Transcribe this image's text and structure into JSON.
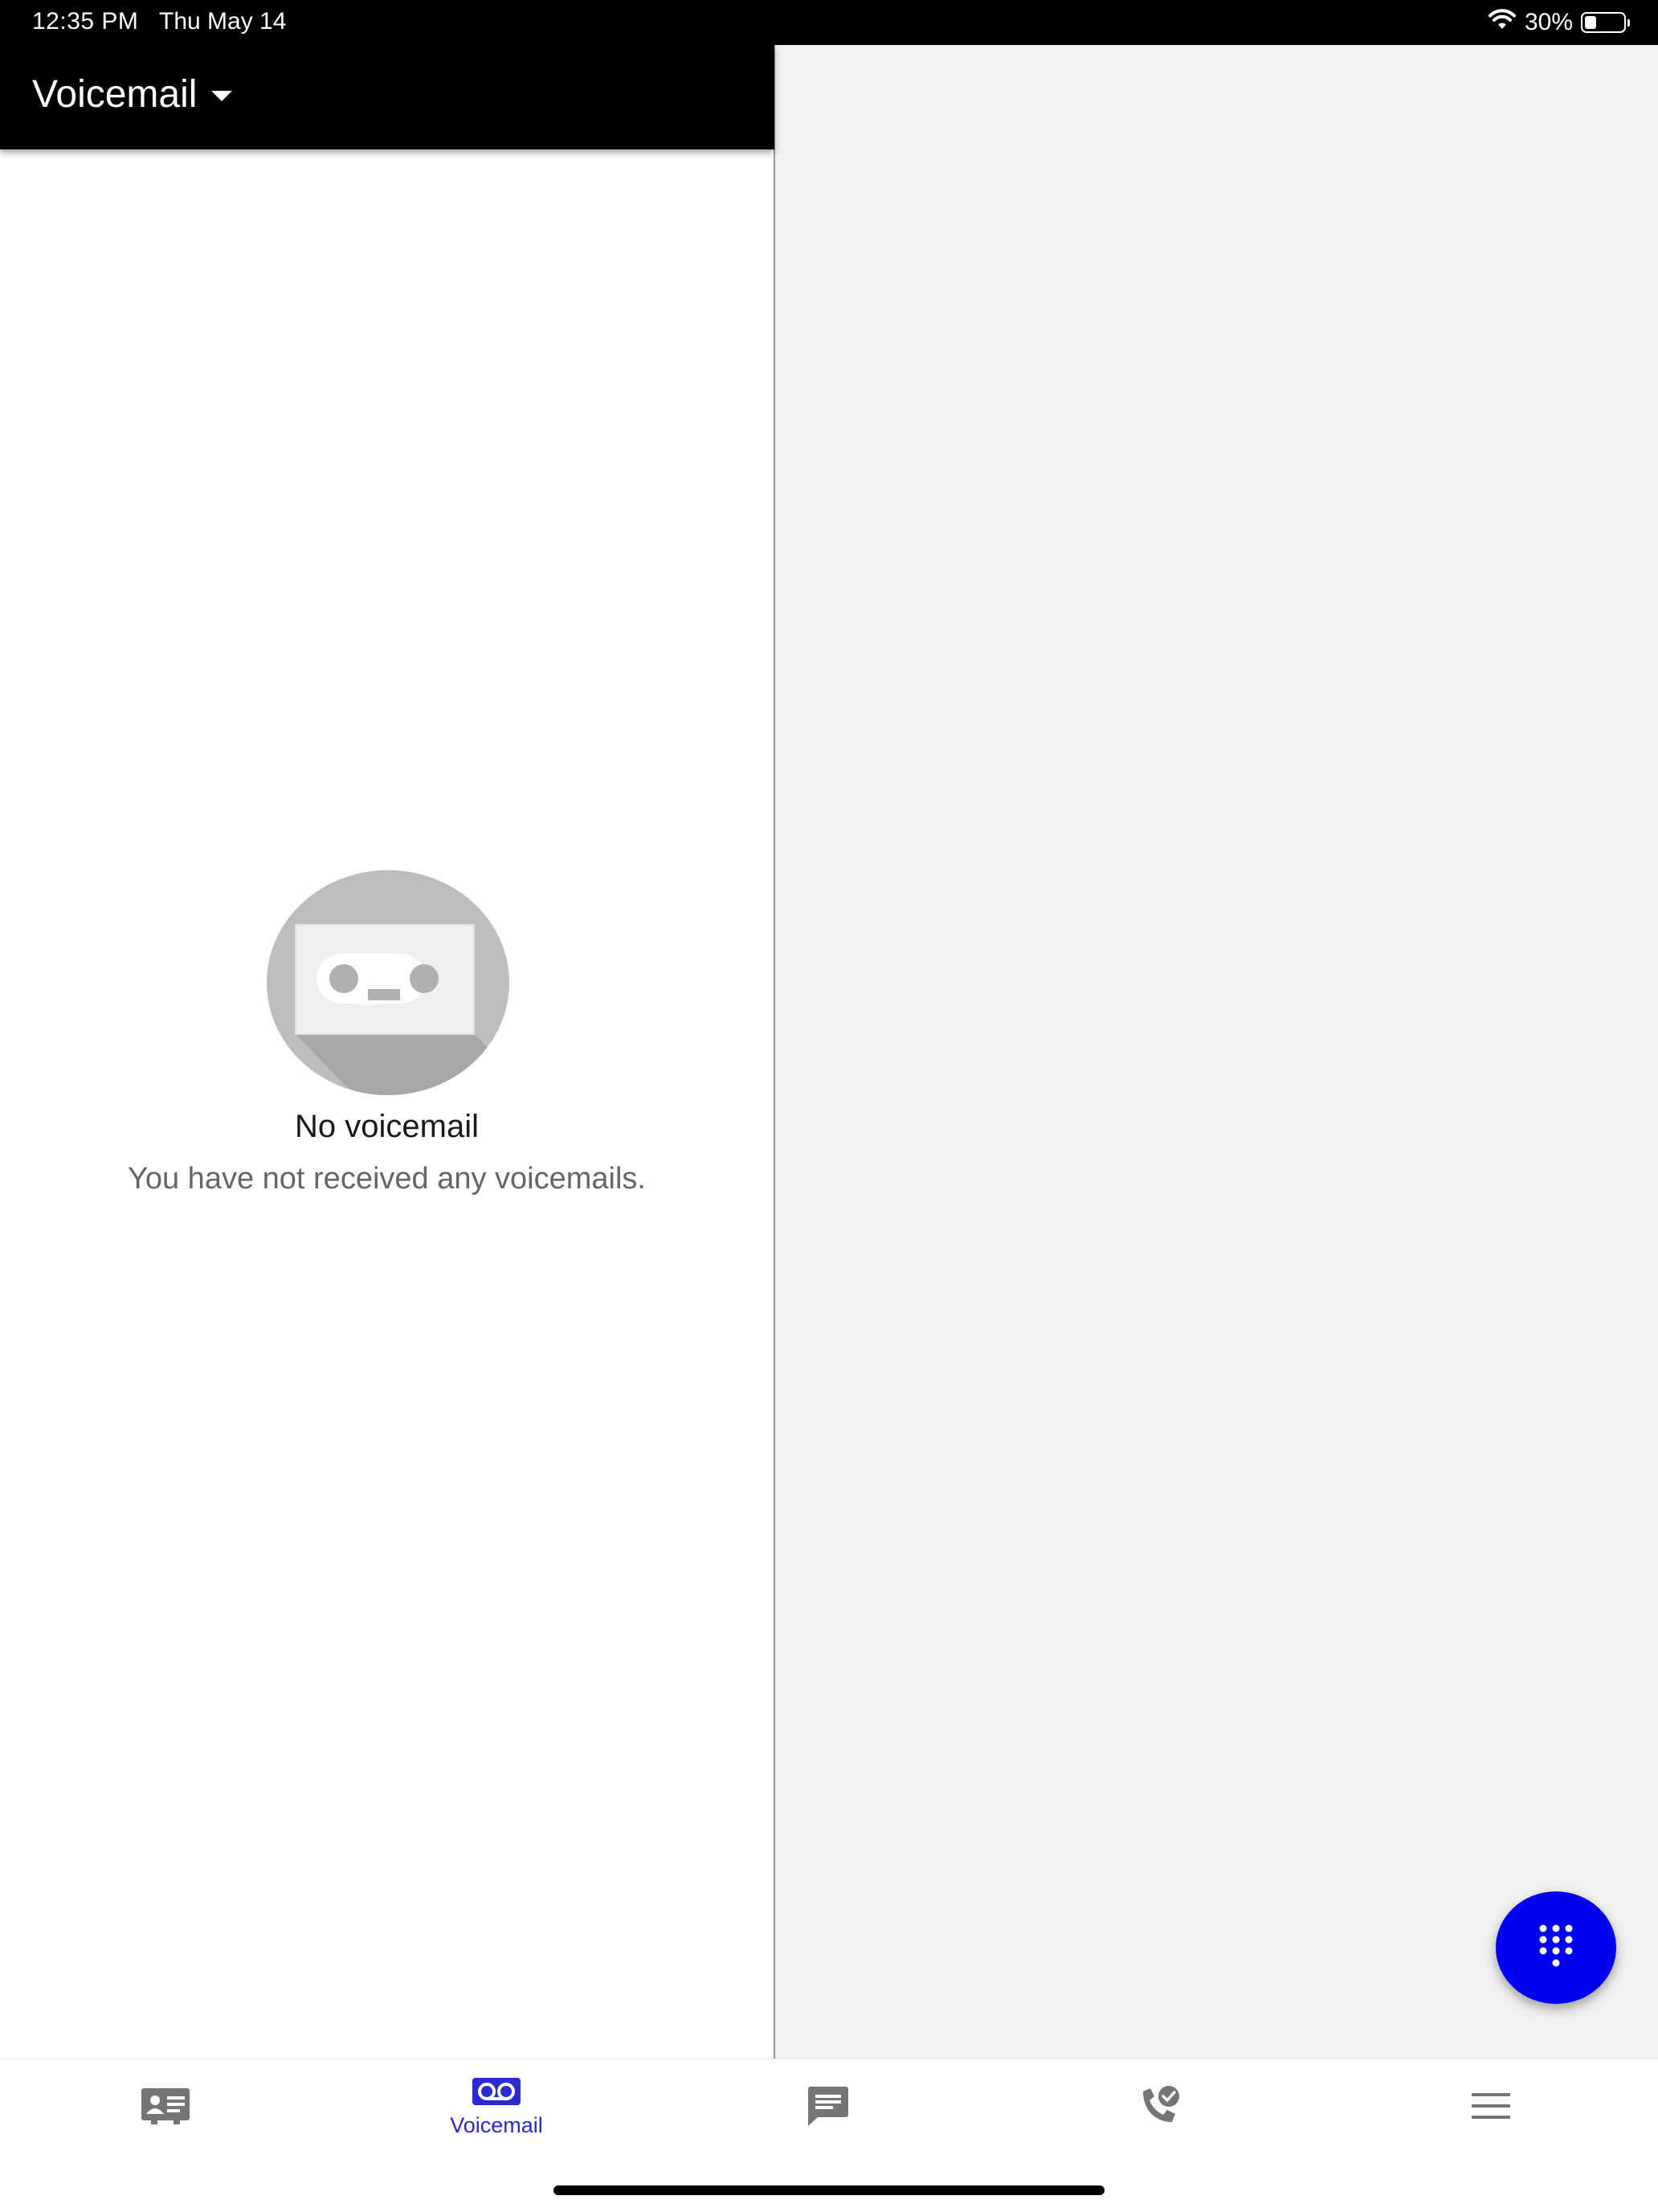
{
  "status_bar": {
    "time": "12:35 PM",
    "date": "Thu May 14",
    "battery_percent_label": "30%",
    "battery_level": 0.3,
    "wifi_icon": "wifi-icon",
    "battery_icon": "battery-icon"
  },
  "header": {
    "title": "Voicemail",
    "dropdown_icon": "caret-down-icon"
  },
  "empty_state": {
    "icon": "voicemail-icon",
    "title": "No voicemail",
    "subtitle": "You have not received any voicemails."
  },
  "fab": {
    "icon": "dialpad-icon",
    "color": "#0000f0"
  },
  "bottom_nav": {
    "items": [
      {
        "icon": "contacts-card-icon",
        "label": ""
      },
      {
        "icon": "voicemail-icon",
        "label": "Voicemail",
        "selected": true
      },
      {
        "icon": "chat-message-icon",
        "label": ""
      },
      {
        "icon": "call-history-icon",
        "label": ""
      },
      {
        "icon": "menu-icon",
        "label": ""
      }
    ]
  },
  "colors": {
    "accent": "#0000f0",
    "selected_nav": "#2a2ad0",
    "icon_gray": "#757575",
    "header_bg": "#000000",
    "detail_pane_bg": "#f1f1f1"
  }
}
